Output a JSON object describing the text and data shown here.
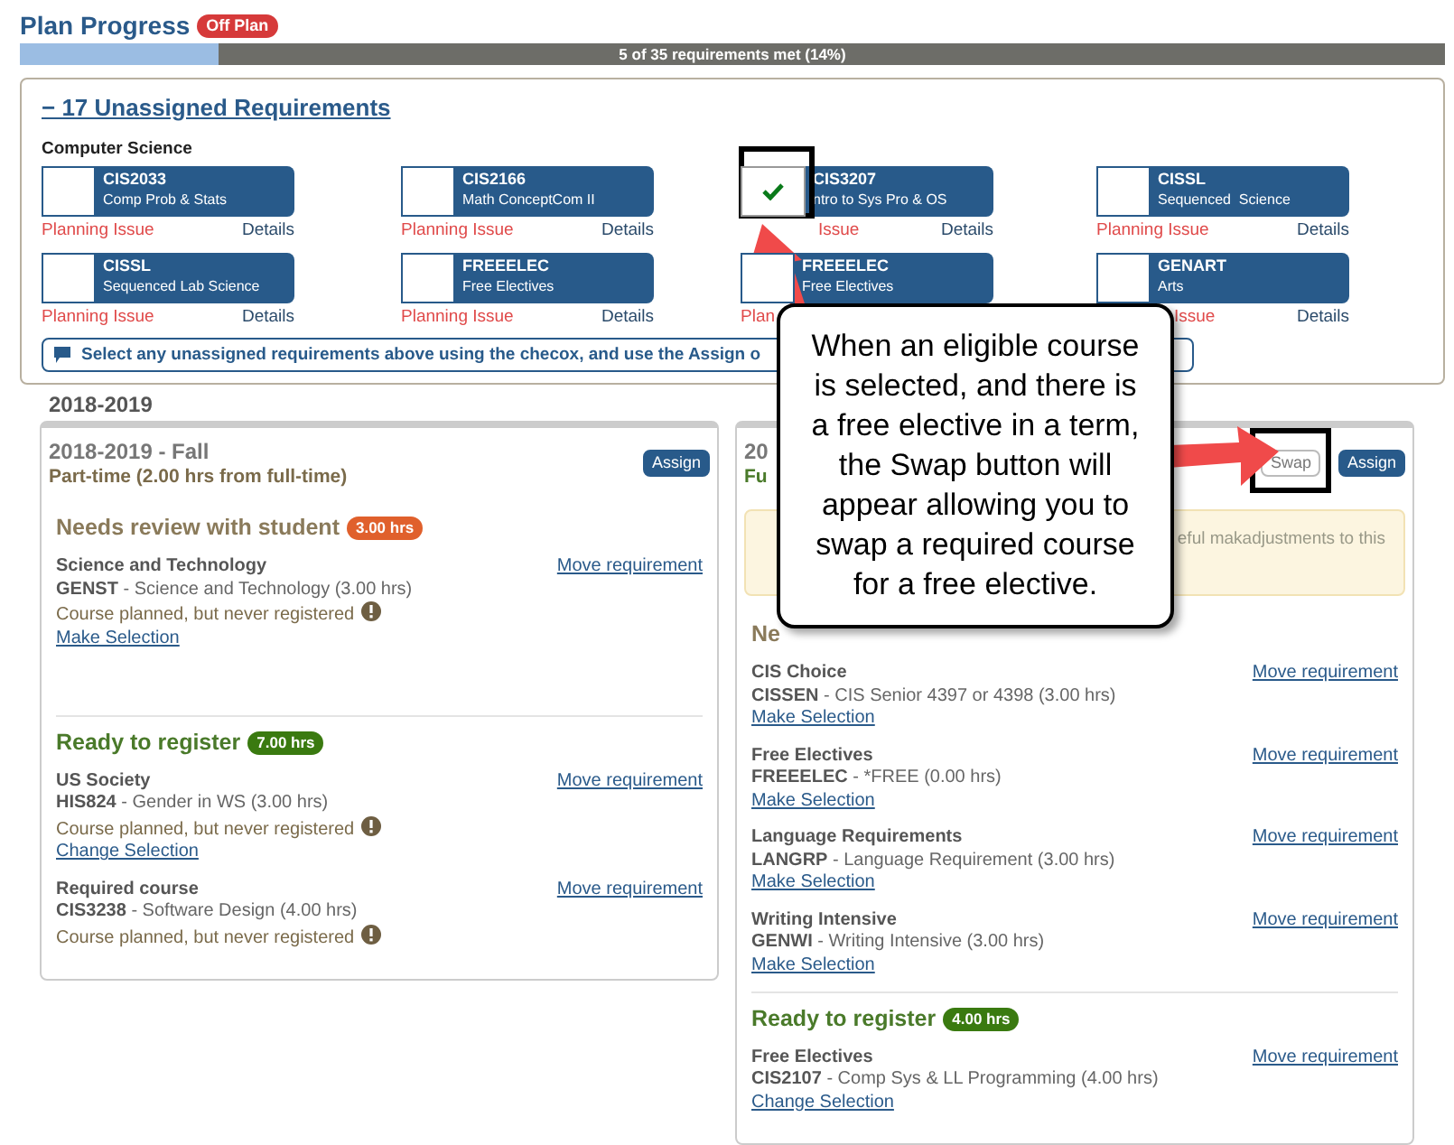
{
  "header": {
    "title": "Plan Progress",
    "badge": "Off Plan"
  },
  "progress": {
    "level": 0.14,
    "label": "5 of 35 requirements met (14%)"
  },
  "unassigned": {
    "toggle": "−",
    "title": "17 Unassigned Requirements",
    "expanded": true,
    "group": "Computer Science",
    "requirements": [
      {
        "kind": "plain",
        "code": "CIS2033",
        "name": "Comp Prob & Stats",
        "checked": false,
        "issue": "Planning Issue",
        "details": "Details"
      },
      {
        "kind": "plain",
        "code": "CIS2166",
        "name": "Math ConceptCom II",
        "checked": false,
        "issue": "Planning Issue",
        "details": "Details"
      },
      {
        "kind": "tail",
        "code": "CIS3207",
        "name": "ntro to Sys Pro & OS",
        "checked": true,
        "issue": "Issue",
        "details": "Details"
      },
      {
        "kind": "plain",
        "code": "CISSL",
        "name": "Sequenced  Science",
        "checked": false,
        "issue": "Planning Issue",
        "details": "Details"
      },
      {
        "kind": "plain",
        "code": "CISSL",
        "name": "Sequenced Lab Science",
        "checked": false,
        "issue": "Planning Issue",
        "details": "Details"
      },
      {
        "kind": "plain",
        "code": "FREEELEC",
        "name": "Free Electives",
        "checked": false,
        "issue": "Planning Issue",
        "details": "Details"
      },
      {
        "kind": "plain",
        "code": "FREEELEC",
        "name": "Free Electives",
        "checked": false,
        "issue": "Plan"
      },
      {
        "kind": "tail",
        "code": "GENART",
        "name": "Arts",
        "checked": false,
        "issue": "Issue",
        "details": "Details"
      }
    ],
    "info": "Select any unassigned requirements above using the checox, and use the Assign o"
  },
  "year": "2018-2019",
  "terms": [
    {
      "title": "2018-2019 - Fall",
      "subtitle": "Part-time (2.00 hrs from full-time)",
      "kind": "part",
      "buttons": [
        {
          "label": "Assign",
          "kind": "assign",
          "highlighted": false
        }
      ],
      "sections": [
        {
          "kind": "review",
          "title": "Needs review with student",
          "hours": "3.00 hrs",
          "items": [
            {
              "category": "Science and Technology",
              "code": "GENST",
              "desc": " - Science and Technology (3.00 hrs)",
              "status": "Course planned, but never registered",
              "link": "Make Selection",
              "move": "Move requirement"
            }
          ]
        },
        {
          "kind": "ready",
          "title": "Ready to register",
          "hours": "7.00 hrs",
          "items": [
            {
              "category": "US Society",
              "code": "HIS824",
              "desc": " - Gender in WS (3.00 hrs)",
              "status": "Course planned, but never registered",
              "link": "Change Selection",
              "move": "Move requirement"
            },
            {
              "category": "Required course",
              "code": "CIS3238",
              "desc": " - Software Design (4.00 hrs)",
              "status": "Course planned, but never registered",
              "move": "Move requirement"
            }
          ]
        }
      ]
    },
    {
      "title": "20",
      "subtitle": "Fu",
      "kind": "full",
      "alert": "eful makadjustments to this",
      "buttons": [
        {
          "label": "Swap",
          "kind": "swap",
          "highlighted": true
        },
        {
          "label": "Assign",
          "kind": "assign",
          "highlighted": false
        }
      ],
      "sections": [
        {
          "kind": "review",
          "title": "Ne",
          "items": [
            {
              "category": "CIS Choice",
              "code": "CISSEN",
              "desc": " - CIS Senior 4397 or 4398 (3.00 hrs)",
              "link": "Make Selection",
              "move": "Move requirement"
            },
            {
              "category": "Free Electives",
              "code": "FREEELEC",
              "desc": " - *FREE (0.00 hrs)",
              "link": "Make Selection",
              "move": "Move requirement"
            },
            {
              "category": "Language Requirements",
              "code": "LANGRP",
              "desc": " - Language Requirement (3.00 hrs)",
              "link": "Make Selection",
              "move": "Move requirement"
            },
            {
              "category": "Writing Intensive",
              "code": "GENWI",
              "desc": " - Writing Intensive (3.00 hrs)",
              "link": "Make Selection",
              "move": "Move requirement"
            }
          ]
        },
        {
          "kind": "ready",
          "title": "Ready to register",
          "hours": "4.00 hrs",
          "items": [
            {
              "category": "Free Electives",
              "code": "CIS2107",
              "desc": " - Comp Sys & LL Programming (4.00 hrs)",
              "link": "Change Selection",
              "move": "Move requirement"
            }
          ]
        }
      ]
    }
  ],
  "callout": {
    "text": "When an eligible course is selected, and there is a free elective in a term, the Swap button will appear allowing you to swap a required course for a free elective."
  }
}
